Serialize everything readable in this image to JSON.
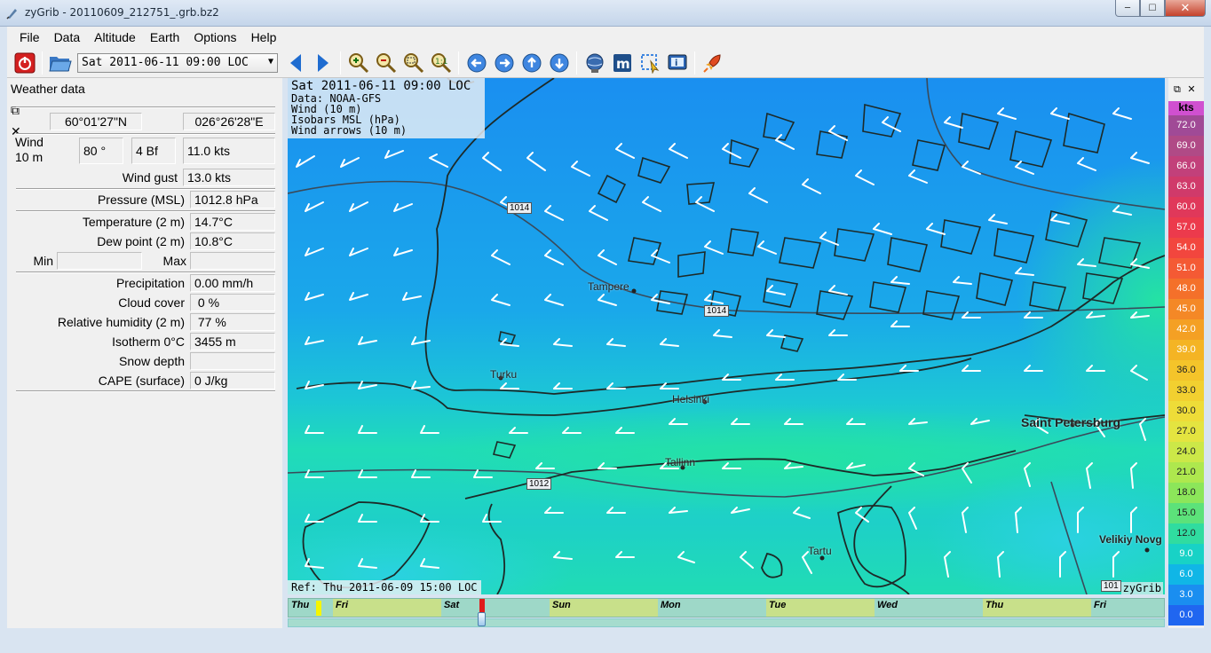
{
  "window": {
    "title": "zyGrib - 20110609_212751_.grb.bz2"
  },
  "menu": [
    "File",
    "Data",
    "Altitude",
    "Earth",
    "Options",
    "Help"
  ],
  "toolbar": {
    "date_value": "Sat 2011-06-11 09:00 LOC"
  },
  "weather_panel": {
    "title": "Weather data",
    "lat": "60°01'27\"N",
    "lon": "026°26'28\"E",
    "wind_label": "Wind\n10 m",
    "wind_dir": "80 °",
    "wind_bf": "4 Bf",
    "wind_kts": "11.0  kts",
    "gust_label": "Wind gust",
    "gust_value": "13.0  kts",
    "pressure_label": "Pressure (MSL)",
    "pressure_value": "1012.8 hPa",
    "temp_label": "Temperature (2 m)",
    "temp_value": "14.7°C",
    "dew_label": "Dew point (2 m)",
    "dew_value": "10.8°C",
    "min_label": "Min",
    "max_label": "Max",
    "min_value": "",
    "max_value": "",
    "precip_label": "Precipitation",
    "precip_value": "0.00 mm/h",
    "cloud_label": "Cloud cover",
    "cloud_value": " 0 %",
    "rh_label": "Relative humidity (2 m)",
    "rh_value": " 77 %",
    "iso_label": "Isotherm 0°C",
    "iso_value": "3455 m",
    "snow_label": "Snow depth",
    "snow_value": "",
    "cape_label": "CAPE (surface)",
    "cape_value": "0 J/kg"
  },
  "map": {
    "info_line1": "Sat 2011-06-11 09:00 LOC",
    "info_line2": "Data: NOAA-GFS",
    "info_line3": "Wind (10 m)",
    "info_line4": "Isobars MSL (hPa)",
    "info_line5": "Wind arrows (10 m)",
    "ref": "Ref: Thu 2011-06-09 15:00 LOC",
    "watermark": "zyGrib",
    "cities": {
      "tampere": "Tampere",
      "turku": "Turku",
      "helsinki": "Helsinki",
      "tallinn": "Tallinn",
      "tartu": "Tartu",
      "saint_petersburg": "Saint Petersburg",
      "velikiy": "Velikiy Novg"
    },
    "isobar_labels": {
      "a": "1014",
      "b": "1014",
      "c": "1012",
      "d": "101"
    }
  },
  "timeline": {
    "days": [
      "Thu",
      "Fri",
      "Sat",
      "Sun",
      "Mon",
      "Tue",
      "Wed",
      "Thu",
      "Fri"
    ]
  },
  "scale": {
    "unit": "kts",
    "values": [
      "72.0",
      "69.0",
      "66.0",
      "63.0",
      "60.0",
      "57.0",
      "54.0",
      "51.0",
      "48.0",
      "45.0",
      "42.0",
      "39.0",
      "36.0",
      "33.0",
      "30.0",
      "27.0",
      "24.0",
      "21.0",
      "18.0",
      "15.0",
      "12.0",
      "9.0",
      "6.0",
      "3.0",
      "0.0"
    ],
    "colors": [
      "#a04a96",
      "#b04a86",
      "#c2407a",
      "#d03a6a",
      "#e0385a",
      "#ec3a4c",
      "#f2463e",
      "#f45a34",
      "#f4702a",
      "#f48826",
      "#f4a024",
      "#f4b424",
      "#f4c42a",
      "#f2d030",
      "#eedc38",
      "#e4e440",
      "#cce848",
      "#aee84e",
      "#8ce65a",
      "#5ce27a",
      "#30dca0",
      "#18d2c6",
      "#10b6e6",
      "#1a8ef0",
      "#2066f0"
    ]
  }
}
